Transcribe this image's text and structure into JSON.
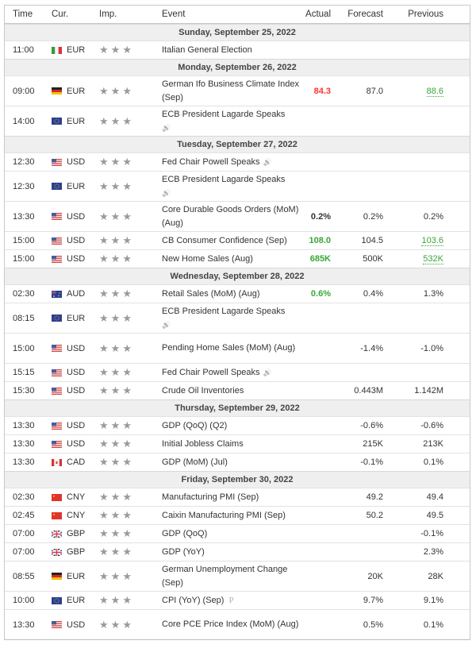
{
  "header": {
    "time": "Time",
    "currency": "Cur.",
    "importance": "Imp.",
    "event": "Event",
    "actual": "Actual",
    "forecast": "Forecast",
    "previous": "Previous"
  },
  "colors": {
    "better": "#3aa53a",
    "worse": "#ff3333",
    "star": "#9a9a9a",
    "day_bg": "#efefef"
  },
  "days": [
    {
      "date": "Sunday, September 25, 2022",
      "events": [
        {
          "time": "11:00",
          "flag": "italy",
          "currency": "EUR",
          "stars": 3,
          "event": "Italian General Election",
          "speaker": false,
          "actual": "",
          "forecast": "",
          "previous": ""
        }
      ]
    },
    {
      "date": "Monday, September 26, 2022",
      "events": [
        {
          "time": "09:00",
          "flag": "germany",
          "currency": "EUR",
          "stars": 3,
          "event": "German Ifo Business Climate Index (Sep)",
          "speaker": false,
          "actual": "84.3",
          "actual_status": "worse",
          "forecast": "87.0",
          "previous": "88.6",
          "previous_status": "revised-better"
        },
        {
          "time": "14:00",
          "flag": "eu",
          "currency": "EUR",
          "stars": 3,
          "event": "ECB President Lagarde Speaks",
          "speaker": true,
          "actual": "",
          "forecast": "",
          "previous": ""
        }
      ]
    },
    {
      "date": "Tuesday, September 27, 2022",
      "events": [
        {
          "time": "12:30",
          "flag": "usa",
          "currency": "USD",
          "stars": 3,
          "event": "Fed Chair Powell Speaks",
          "speaker": true,
          "actual": "",
          "forecast": "",
          "previous": ""
        },
        {
          "time": "12:30",
          "flag": "eu",
          "currency": "EUR",
          "stars": 3,
          "event": "ECB President Lagarde Speaks",
          "speaker": true,
          "actual": "",
          "forecast": "",
          "previous": ""
        },
        {
          "time": "13:30",
          "flag": "usa",
          "currency": "USD",
          "stars": 3,
          "event": "Core Durable Goods Orders (MoM) (Aug)",
          "speaker": false,
          "actual": "0.2%",
          "actual_status": "neutral",
          "forecast": "0.2%",
          "previous": "0.2%"
        },
        {
          "time": "15:00",
          "flag": "usa",
          "currency": "USD",
          "stars": 3,
          "event": "CB Consumer Confidence (Sep)",
          "speaker": false,
          "actual": "108.0",
          "actual_status": "better",
          "forecast": "104.5",
          "previous": "103.6",
          "previous_status": "revised-better"
        },
        {
          "time": "15:00",
          "flag": "usa",
          "currency": "USD",
          "stars": 3,
          "event": "New Home Sales (Aug)",
          "speaker": false,
          "actual": "685K",
          "actual_status": "better",
          "forecast": "500K",
          "previous": "532K",
          "previous_status": "revised-better"
        }
      ]
    },
    {
      "date": "Wednesday, September 28, 2022",
      "events": [
        {
          "time": "02:30",
          "flag": "australia",
          "currency": "AUD",
          "stars": 3,
          "event": "Retail Sales (MoM) (Aug)",
          "speaker": false,
          "actual": "0.6%",
          "actual_status": "better",
          "forecast": "0.4%",
          "previous": "1.3%"
        },
        {
          "time": "08:15",
          "flag": "eu",
          "currency": "EUR",
          "stars": 3,
          "event": "ECB President Lagarde Speaks",
          "speaker": true,
          "actual": "",
          "forecast": "",
          "previous": ""
        },
        {
          "time": "15:00",
          "flag": "usa",
          "currency": "USD",
          "stars": 3,
          "event": "Pending Home Sales (MoM) (Aug)",
          "speaker": false,
          "actual": "",
          "forecast": "-1.4%",
          "previous": "-1.0%"
        },
        {
          "time": "15:15",
          "flag": "usa",
          "currency": "USD",
          "stars": 3,
          "event": "Fed Chair Powell Speaks",
          "speaker": true,
          "actual": "",
          "forecast": "",
          "previous": ""
        },
        {
          "time": "15:30",
          "flag": "usa",
          "currency": "USD",
          "stars": 3,
          "event": "Crude Oil Inventories",
          "speaker": false,
          "actual": "",
          "forecast": "0.443M",
          "previous": "1.142M"
        }
      ]
    },
    {
      "date": "Thursday, September 29, 2022",
      "events": [
        {
          "time": "13:30",
          "flag": "usa",
          "currency": "USD",
          "stars": 3,
          "event": "GDP (QoQ) (Q2)",
          "speaker": false,
          "actual": "",
          "forecast": "-0.6%",
          "previous": "-0.6%"
        },
        {
          "time": "13:30",
          "flag": "usa",
          "currency": "USD",
          "stars": 3,
          "event": "Initial Jobless Claims",
          "speaker": false,
          "actual": "",
          "forecast": "215K",
          "previous": "213K"
        },
        {
          "time": "13:30",
          "flag": "canada",
          "currency": "CAD",
          "stars": 3,
          "event": "GDP (MoM) (Jul)",
          "speaker": false,
          "actual": "",
          "forecast": "-0.1%",
          "previous": "0.1%"
        }
      ]
    },
    {
      "date": "Friday, September 30, 2022",
      "events": [
        {
          "time": "02:30",
          "flag": "china",
          "currency": "CNY",
          "stars": 3,
          "event": "Manufacturing PMI (Sep)",
          "speaker": false,
          "actual": "",
          "forecast": "49.2",
          "previous": "49.4"
        },
        {
          "time": "02:45",
          "flag": "china",
          "currency": "CNY",
          "stars": 3,
          "event": "Caixin Manufacturing PMI (Sep)",
          "speaker": false,
          "actual": "",
          "forecast": "50.2",
          "previous": "49.5"
        },
        {
          "time": "07:00",
          "flag": "uk",
          "currency": "GBP",
          "stars": 3,
          "event": "GDP (QoQ)",
          "speaker": false,
          "actual": "",
          "forecast": "",
          "previous": "-0.1%"
        },
        {
          "time": "07:00",
          "flag": "uk",
          "currency": "GBP",
          "stars": 3,
          "event": "GDP (YoY)",
          "speaker": false,
          "actual": "",
          "forecast": "",
          "previous": "2.3%"
        },
        {
          "time": "08:55",
          "flag": "germany",
          "currency": "EUR",
          "stars": 3,
          "event": "German Unemployment Change (Sep)",
          "speaker": false,
          "actual": "",
          "forecast": "20K",
          "previous": "28K"
        },
        {
          "time": "10:00",
          "flag": "eu",
          "currency": "EUR",
          "stars": 3,
          "event": "CPI (YoY) (Sep)",
          "preliminary": "P",
          "speaker": false,
          "actual": "",
          "forecast": "9.7%",
          "previous": "9.1%"
        },
        {
          "time": "13:30",
          "flag": "usa",
          "currency": "USD",
          "stars": 3,
          "event": "Core PCE Price Index (MoM) (Aug)",
          "speaker": false,
          "actual": "",
          "forecast": "0.5%",
          "previous": "0.1%"
        }
      ]
    }
  ]
}
